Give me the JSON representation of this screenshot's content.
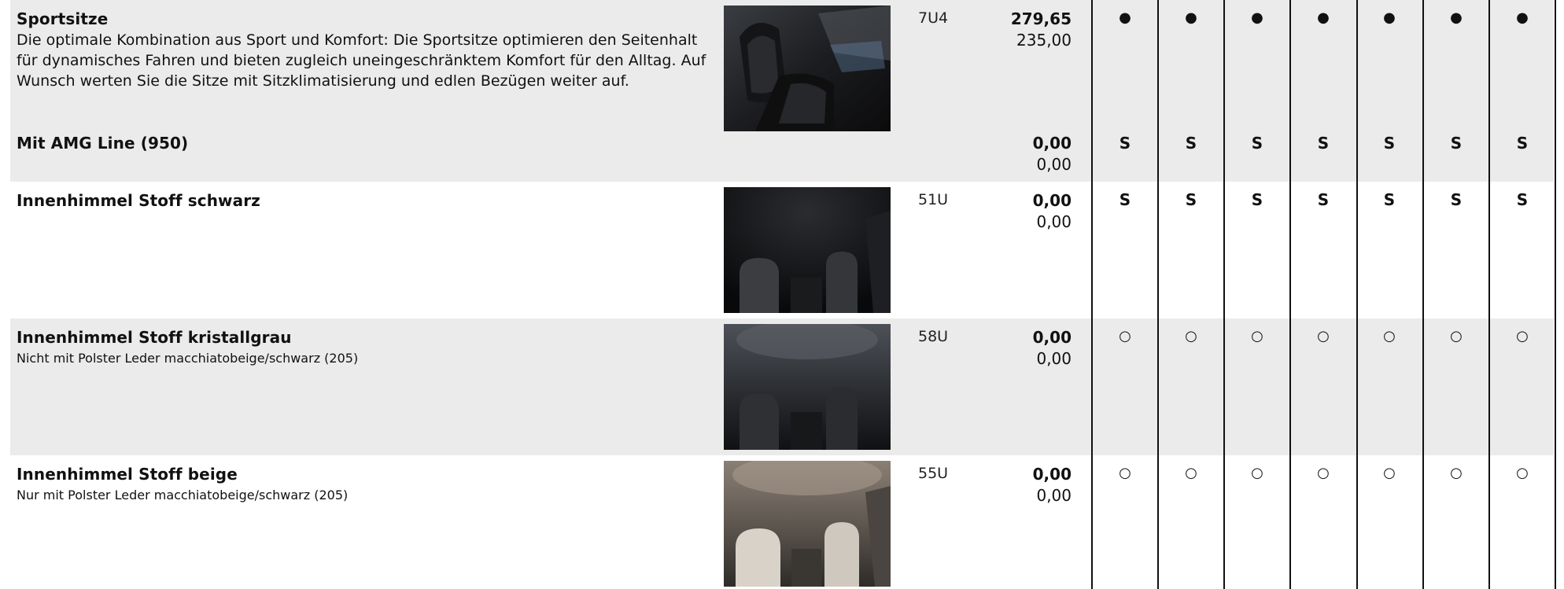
{
  "rows": [
    {
      "title": "Sportsitze",
      "description": "Die optimale Kombination aus Sport und Komfort: Die Sportsitze optimieren den Seitenhalt für dynamisches Fahren und bieten zugleich uneingeschränktem Komfort für den Alltag. Auf Wunsch werten Sie die Sitze mit Sitzklimatisierung und edlen Bezügen weiter auf.",
      "code": "7U4",
      "price_gross": "279,65",
      "price_net": "235,00",
      "image": "interior-front-seats-dark-photo",
      "marks": [
        "●",
        "●",
        "●",
        "●",
        "●",
        "●",
        "●"
      ],
      "sub": {
        "title": "Mit AMG Line (950)",
        "price_gross": "0,00",
        "price_net": "0,00",
        "marks": [
          "S",
          "S",
          "S",
          "S",
          "S",
          "S",
          "S"
        ]
      }
    },
    {
      "title": "Innenhimmel Stoff schwarz",
      "code": "51U",
      "price_gross": "0,00",
      "price_net": "0,00",
      "image": "headliner-black-photo",
      "marks": [
        "S",
        "S",
        "S",
        "S",
        "S",
        "S",
        "S"
      ]
    },
    {
      "title": "Innenhimmel Stoff kristallgrau",
      "note": "Nicht mit Polster Leder macchiatobeige/schwarz (205)",
      "code": "58U",
      "price_gross": "0,00",
      "price_net": "0,00",
      "image": "headliner-crystal-grey-photo",
      "marks": [
        "○",
        "○",
        "○",
        "○",
        "○",
        "○",
        "○"
      ]
    },
    {
      "title": "Innenhimmel Stoff beige",
      "note": "Nur mit Polster Leder macchiatobeige/schwarz (205)",
      "code": "55U",
      "price_gross": "0,00",
      "price_net": "0,00",
      "image": "headliner-beige-photo",
      "marks": [
        "○",
        "○",
        "○",
        "○",
        "○",
        "○",
        "○"
      ]
    }
  ],
  "colors": {
    "shaded_row": "#ebebeb",
    "text": "#111111",
    "grid_line": "#111111"
  }
}
